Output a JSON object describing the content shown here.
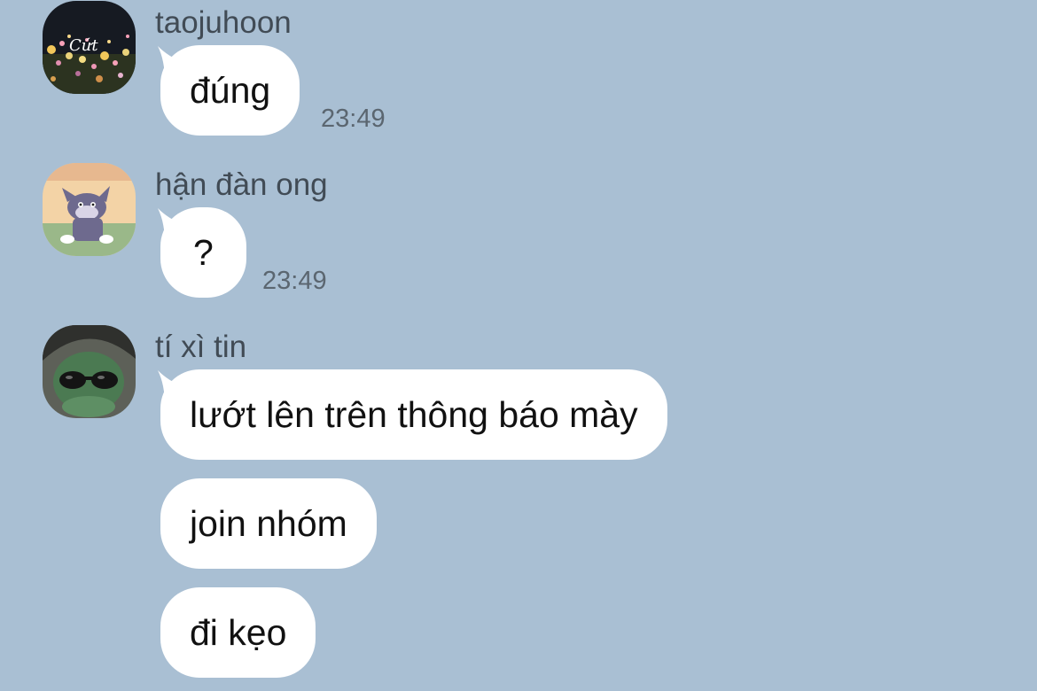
{
  "colors": {
    "background": "#a9bfd3",
    "bubble": "#ffffff",
    "sender_text": "#414b55",
    "time_text": "#5b6670"
  },
  "messages": [
    {
      "sender": "taojuhoon",
      "avatar": "night-flowers-avatar",
      "avatar_caption": "Cứt",
      "bubbles": [
        "đúng"
      ],
      "time": "23:49"
    },
    {
      "sender": "hận đàn ong",
      "avatar": "cartoon-cat-avatar",
      "bubbles": [
        "?"
      ],
      "time": "23:49"
    },
    {
      "sender": "tí xì tin",
      "avatar": "frog-with-sunglasses-avatar",
      "bubbles": [
        "lướt lên trên thông báo mày",
        "join nhóm",
        "đi kẹo"
      ]
    }
  ]
}
